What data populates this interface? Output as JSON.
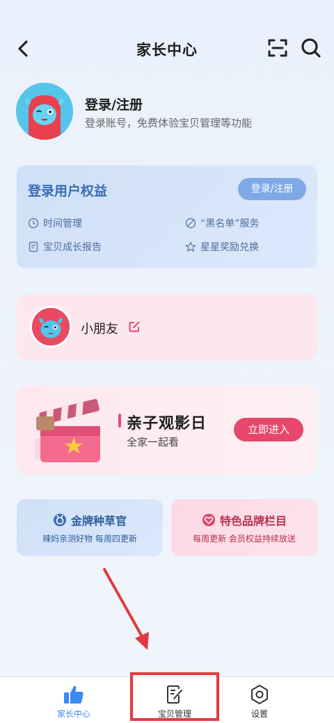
{
  "header": {
    "title": "家长中心",
    "back_icon": "back-icon",
    "scan_icon": "scan-icon",
    "search_icon": "search-icon"
  },
  "profile": {
    "title": "登录/注册",
    "subtitle": "登录账号，免费体验宝贝管理等功能"
  },
  "benefits": {
    "title": "登录用户权益",
    "button_label": "登录/注册",
    "items": [
      {
        "label": "时间管理",
        "icon": "clock-icon"
      },
      {
        "label": "“黑名单”服务",
        "icon": "ban-icon"
      },
      {
        "label": "宝贝成长报告",
        "icon": "report-icon"
      },
      {
        "label": "星星奖励兑换",
        "icon": "star-icon"
      }
    ]
  },
  "child": {
    "name": "小朋友",
    "edit_icon": "edit-icon"
  },
  "movie": {
    "title": "亲子观影日",
    "subtitle": "全家一起看",
    "button_label": "立即进入"
  },
  "promos": [
    {
      "title": "金牌种草官",
      "subtitle": "辣妈亲测好物 每周四更新",
      "icon": "medal-icon"
    },
    {
      "title": "特色品牌栏目",
      "subtitle": "每周更新 会员权益持续放送",
      "icon": "heart-icon"
    }
  ],
  "bottom_nav": [
    {
      "label": "家长中心",
      "icon": "thumbs-up-icon",
      "active": true
    },
    {
      "label": "宝贝管理",
      "icon": "notes-icon",
      "active": false
    },
    {
      "label": "设置",
      "icon": "settings-icon",
      "active": false
    }
  ],
  "colors": {
    "accent_blue": "#3a8af0",
    "accent_pink": "#e6476b",
    "annotation_red": "#e03a3e"
  }
}
